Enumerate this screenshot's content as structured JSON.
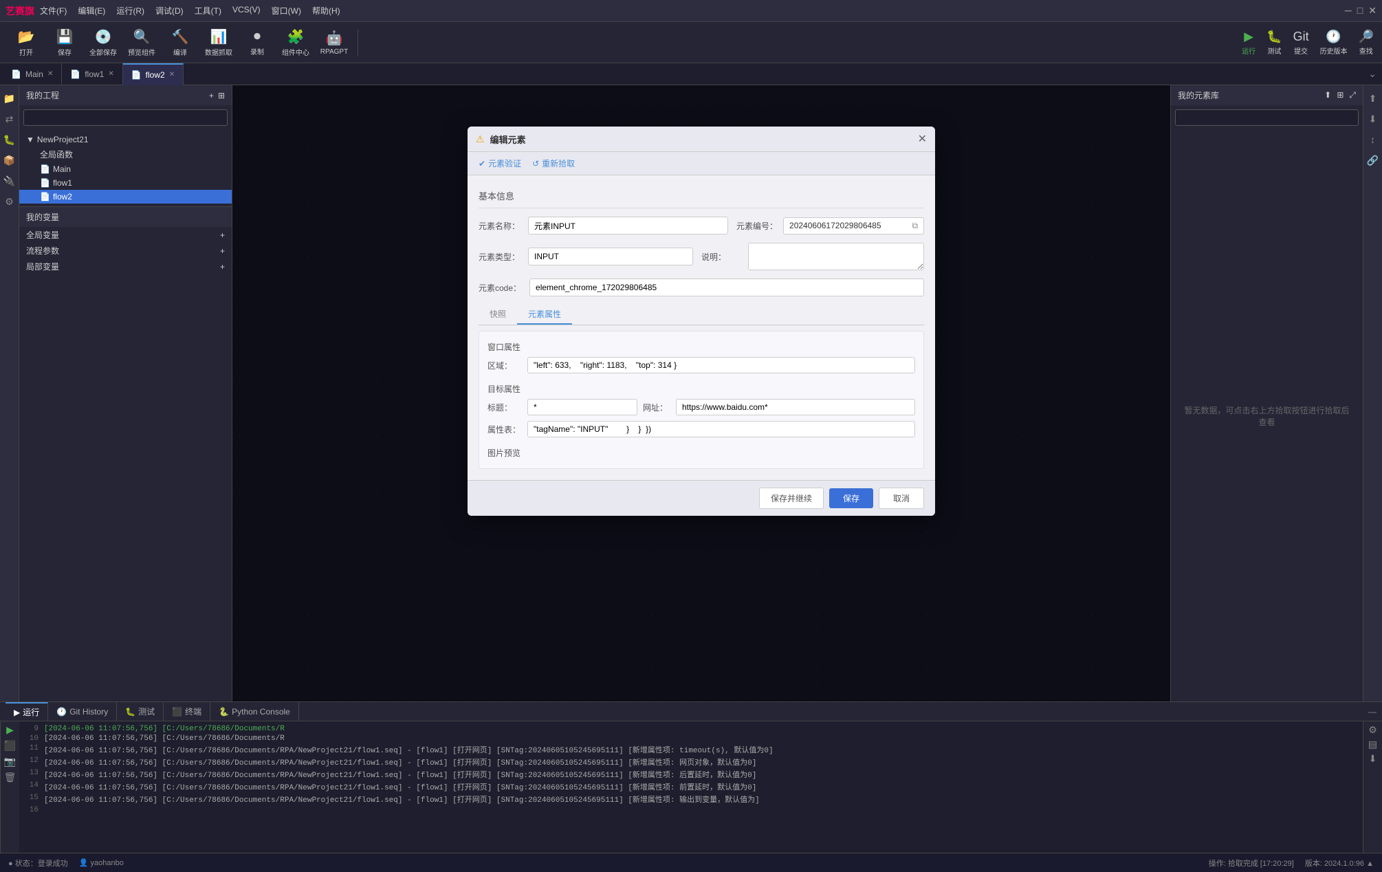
{
  "titlebar": {
    "logo": "艺赛旗",
    "menu": [
      "文件(F)",
      "编辑(E)",
      "运行(R)",
      "调试(D)",
      "工具(T)",
      "VCS(V)",
      "窗口(W)",
      "帮助(H)"
    ],
    "controls": [
      "─",
      "□",
      "✕"
    ]
  },
  "toolbar": {
    "buttons": [
      {
        "id": "open",
        "icon": "📂",
        "label": "打开"
      },
      {
        "id": "save",
        "icon": "💾",
        "label": "保存"
      },
      {
        "id": "save-all",
        "icon": "💿",
        "label": "全部保存"
      },
      {
        "id": "preview",
        "icon": "🔍",
        "label": "预览组件"
      },
      {
        "id": "compile",
        "icon": "🔨",
        "label": "编译"
      },
      {
        "id": "data-extract",
        "icon": "📊",
        "label": "数据抓取"
      },
      {
        "id": "record",
        "icon": "⏺",
        "label": "录制"
      },
      {
        "id": "component-center",
        "icon": "🧩",
        "label": "组件中心"
      },
      {
        "id": "rpagpt",
        "icon": "🤖",
        "label": "RPAGPT"
      }
    ],
    "right_buttons": [
      {
        "id": "run",
        "icon": "▶",
        "label": "运行",
        "color": "#4caf50"
      },
      {
        "id": "debug",
        "icon": "🐛",
        "label": "测试"
      },
      {
        "id": "git",
        "icon": "Git",
        "label": "提交"
      },
      {
        "id": "history",
        "icon": "🕐",
        "label": "历史版本"
      },
      {
        "id": "search-global",
        "icon": "🔎",
        "label": "查找"
      }
    ]
  },
  "tabs": {
    "items": [
      {
        "label": "Main",
        "icon": "📄",
        "active": false,
        "closable": true
      },
      {
        "label": "flow1",
        "icon": "📄",
        "active": false,
        "closable": true
      },
      {
        "label": "flow2",
        "icon": "📄",
        "active": true,
        "closable": true
      }
    ]
  },
  "sidebar_left": {
    "project_title": "我的工程",
    "project_name": "NewProject21",
    "tree_items": [
      {
        "label": "全局函数",
        "indent": 2,
        "icon": ""
      },
      {
        "label": "Main",
        "indent": 2,
        "icon": "📄"
      },
      {
        "label": "flow1",
        "indent": 2,
        "icon": "📄"
      },
      {
        "label": "flow2",
        "indent": 2,
        "icon": "📄",
        "selected": true
      }
    ],
    "search_placeholder": "",
    "variables_title": "我的变量",
    "var_groups": [
      {
        "label": "全局变量",
        "expandable": true
      },
      {
        "label": "流程参数",
        "expandable": true
      },
      {
        "label": "局部变量",
        "expandable": true
      }
    ]
  },
  "sidebar_right": {
    "title": "我的元素库",
    "empty_text": "暂无数据，可点击右上方拾取按钮进行拾取后查看"
  },
  "bottom_panel": {
    "tabs": [
      {
        "label": "运行",
        "icon": "▶",
        "active": true
      },
      {
        "label": "Git History",
        "icon": "🕐",
        "active": false
      },
      {
        "label": "测试",
        "icon": "🐛",
        "active": false
      },
      {
        "label": "终端",
        "icon": "⬛",
        "active": false
      },
      {
        "label": "Python Console",
        "icon": "🐍",
        "active": false
      }
    ],
    "logs": [
      {
        "num": "9",
        "text": "[2024-06-06 11:07:56,756] [C:/Users/78686/Documents/R"
      },
      {
        "num": "10",
        "text": "[2024-06-06 11:07:56,756] [C:/Users/78686/Documents/R"
      },
      {
        "num": "11",
        "text": "[2024-06-06 11:07:56,756] [C:/Users/78686/Documents/RPA/NewProject21/flow1.seq] - [flow1] [打开网页] [SNTag:20240605105245695111] [新增属性项: timeout(s), 默认值为0]"
      },
      {
        "num": "12",
        "text": "[2024-06-06 11:07:56,756] [C:/Users/78686/Documents/RPA/NewProject21/flow1.seq] - [flow1] [打开网页] [SNTag:20240605105245695111] [新增属性项: 网页对象，默认值为0]"
      },
      {
        "num": "13",
        "text": "[2024-06-06 11:07:56,756] [C:/Users/78686/Documents/RPA/NewProject21/flow1.seq] - [flow1] [打开网页] [SNTag:20240605105245695111] [新增属性项: 后置延时，默认值为0]"
      },
      {
        "num": "14",
        "text": "[2024-06-06 11:07:56,756] [C:/Users/78686/Documents/RPA/NewProject21/flow1.seq] - [flow1] [打开网页] [SNTag:20240605105245695111] [新增属性项: 前置延时，默认值为0]"
      },
      {
        "num": "15",
        "text": "[2024-06-06 11:07:56,756] [C:/Users/78686/Documents/RPA/NewProject21/flow1.seq] - [flow1] [打开网页] [SNTag:20240605105245695111] [新增属性项: 输出到变量，默认值为]"
      },
      {
        "num": "16",
        "text": ""
      }
    ]
  },
  "status_bar": {
    "left": "状态：登录成功",
    "user": "yaohanbo",
    "status_text": "操作: 拾取完成 [17:20:29]",
    "version": "版本: 2024.1.0:96 ▲"
  },
  "modal": {
    "title": "编辑元素",
    "toolbar_btns": [
      {
        "icon": "✔",
        "label": "元素验证"
      },
      {
        "icon": "↺",
        "label": "重新拾取"
      }
    ],
    "section_basic": "基本信息",
    "field_name_label": "元素名称：",
    "field_name_value": "元素INPUT",
    "field_id_label": "元素编号：",
    "field_id_value": "20240606172029806485",
    "field_type_label": "元素类型：",
    "field_type_value": "INPUT",
    "field_desc_label": "说明：",
    "field_desc_value": "",
    "field_code_label": "元素code：",
    "field_code_value": "element_chrome_172029806485",
    "tabs": [
      "快照",
      "元素属性"
    ],
    "active_tab": "元素属性",
    "section_window": "窗口属性",
    "field_region_label": "区域：",
    "field_region_value": "\"left\": 633,    \"right\": 1183,    \"top\": 314 }",
    "section_target": "目标属性",
    "field_label_label": "标题：",
    "field_label_value": "*",
    "field_url_label": "网址：",
    "field_url_value": "https://www.baidu.com*",
    "field_attrs_label": "属性表：",
    "field_attrs_value": "\"tagName\": \"INPUT\"        }    }  })",
    "section_image": "图片预览",
    "btn_save_continue": "保存并继续",
    "btn_save": "保存",
    "btn_cancel": "取消"
  },
  "icon_strip_left": [
    "📁",
    "🔀",
    "🐛",
    "📦",
    "🔌",
    "⚙"
  ],
  "icon_strip_right": [
    "⬆",
    "⬇",
    "↕",
    "🔗"
  ],
  "colors": {
    "accent": "#4a90d9",
    "success": "#4caf50",
    "warning": "#f0a500",
    "primary_btn": "#3a6fd8"
  }
}
